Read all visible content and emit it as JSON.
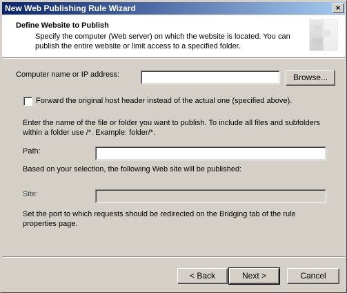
{
  "window": {
    "title": "New Web Publishing Rule Wizard",
    "close_glyph": "×"
  },
  "header": {
    "title": "Define Website to Publish",
    "subtitle": "Specify the computer (Web server) on which the website is located. You can publish the entire website or limit access to a specified folder."
  },
  "form": {
    "computer_label": "Computer name or IP address:",
    "computer_value": "",
    "browse_label": "Browse...",
    "forward_header_label": "Forward the original host header instead of the actual one (specified above).",
    "forward_header_checked": false,
    "path_instructions": "Enter the name of the file or folder you want to publish. To include all files and subfolders within a folder use /*. Example: folder/*.",
    "path_label": "Path:",
    "path_value": "",
    "selection_text": "Based on your selection, the following Web site will be published:",
    "site_label": "Site:",
    "site_value": "",
    "port_text": "Set the port to which requests should be redirected on the Bridging tab of the rule properties page."
  },
  "footer": {
    "back_label": "< Back",
    "next_label": "Next >",
    "cancel_label": "Cancel"
  }
}
